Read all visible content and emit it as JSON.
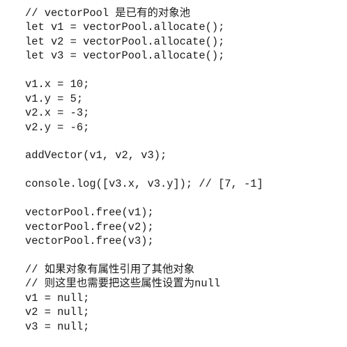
{
  "code": {
    "lines": [
      "// vectorPool 是已有的对象池",
      "let v1 = vectorPool.allocate();",
      "let v2 = vectorPool.allocate();",
      "let v3 = vectorPool.allocate();",
      "",
      "v1.x = 10;",
      "v1.y = 5;",
      "v2.x = -3;",
      "v2.y = -6;",
      "",
      "addVector(v1, v2, v3);",
      "",
      "console.log([v3.x, v3.y]); // [7, -1]",
      "",
      "vectorPool.free(v1);",
      "vectorPool.free(v2);",
      "vectorPool.free(v3);",
      "",
      "// 如果对象有属性引用了其他对象",
      "// 则这里也需要把这些属性设置为null",
      "v1 = null;",
      "v2 = null;",
      "v3 = null;"
    ]
  }
}
